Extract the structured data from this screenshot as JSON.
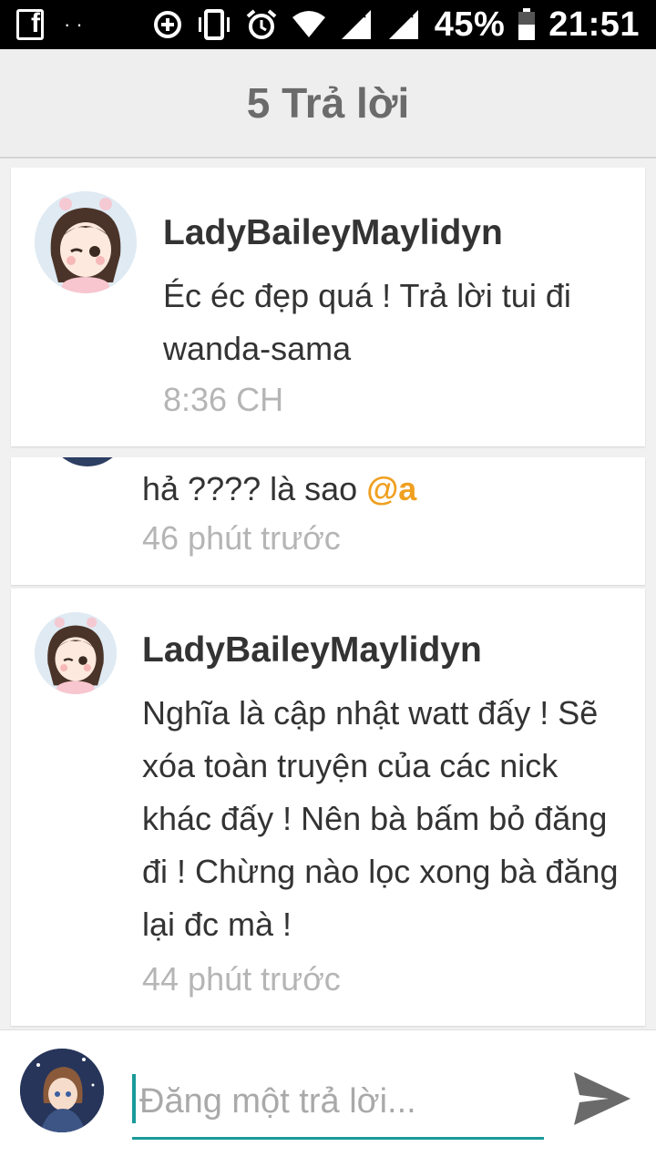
{
  "status_bar": {
    "battery_percent": "45%",
    "time": "21:51",
    "fb_label": "f",
    "dots": "··",
    "icons": [
      "facebook-icon",
      "data-saver-icon",
      "vibrate-icon",
      "alarm-icon",
      "wifi-icon",
      "signal-icon",
      "signal-icon",
      "battery-icon"
    ]
  },
  "header": {
    "title": "5 Trả lời"
  },
  "comments": [
    {
      "username": "LadyBaileyMaylidyn",
      "message": "Éc éc đẹp quá ! Trả lời tui đi wanda-sama",
      "time": "8:36 CH"
    },
    {
      "message_prefix": "hả ???? là sao ",
      "mention": "@a",
      "time": "46 phút trước"
    },
    {
      "username": "LadyBaileyMaylidyn",
      "message": "Nghĩa là cập nhật watt đấy ! Sẽ xóa toàn truyện của các nick khác đấy ! Nên bà bấm bỏ đăng đi ! Chừng nào lọc xong bà đăng lại đc mà !",
      "time": "44 phút trước"
    }
  ],
  "composer": {
    "placeholder": "Đăng một trả lời...",
    "value": ""
  },
  "colors": {
    "accent": "#1a9a9a",
    "mention": "#f0a020",
    "header_text": "#6b6b6b",
    "timestamp": "#b5b5b5"
  }
}
